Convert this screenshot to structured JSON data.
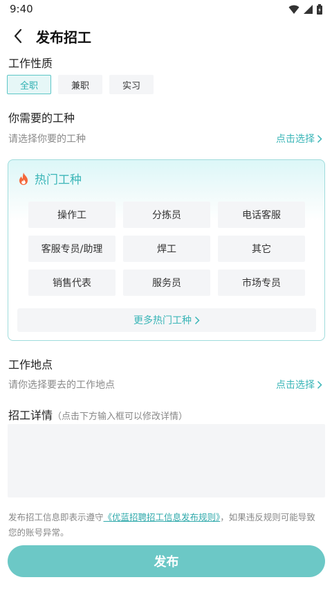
{
  "status": {
    "time": "9:40"
  },
  "nav": {
    "title": "发布招工"
  },
  "work_type": {
    "title": "工作性质",
    "options": [
      {
        "label": "全职",
        "selected": true
      },
      {
        "label": "兼职",
        "selected": false
      },
      {
        "label": "实习",
        "selected": false
      }
    ]
  },
  "job_kind": {
    "title": "你需要的工种",
    "hint": "请选择你要的工种",
    "pick_label": "点击选择"
  },
  "hot_jobs": {
    "title": "热门工种",
    "items": [
      "操作工",
      "分拣员",
      "电话客服",
      "客服专员/助理",
      "焊工",
      "其它",
      "销售代表",
      "服务员",
      "市场专员"
    ],
    "more_label": "更多热门工种"
  },
  "location": {
    "title": "工作地点",
    "hint": "请你选择要去的工作地点",
    "pick_label": "点击选择"
  },
  "details": {
    "title": "招工详情",
    "note": "（点击下方输入框可以修改详情）",
    "value": ""
  },
  "agreement": {
    "prefix": "发布招工信息即表示遵守",
    "link": "《优蓝招聘招工信息发布规则》",
    "suffix": "，如果违反规则可能导致您的账号异常。"
  },
  "publish_label": "发布",
  "colors": {
    "accent": "#39b5b7",
    "button": "#6cc8c6",
    "fire": "#f4683b"
  }
}
